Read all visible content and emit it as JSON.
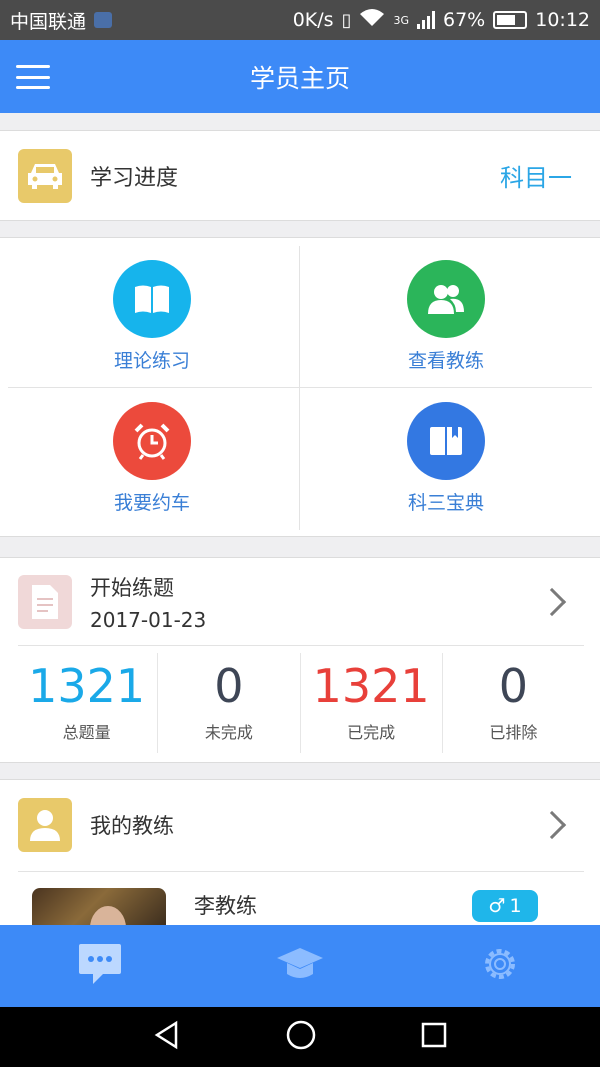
{
  "status_bar": {
    "carrier": "中国联通",
    "speed": "0K/s",
    "network": "3G",
    "battery": "67%",
    "time": "10:12"
  },
  "app_bar": {
    "title": "学员主页",
    "menu_icon": "hamburger-menu-icon"
  },
  "progress": {
    "icon": "car-icon",
    "icon_color": "#e8c96a",
    "label": "学习进度",
    "subject": "科目一"
  },
  "features": [
    {
      "label": "理论练习",
      "icon": "book-icon",
      "color": "#16b4ec"
    },
    {
      "label": "查看教练",
      "icon": "people-icon",
      "color": "#2bb55a"
    },
    {
      "label": "我要约车",
      "icon": "alarm-clock-icon",
      "color": "#ec4a3c"
    },
    {
      "label": "科三宝典",
      "icon": "bookmark-book-icon",
      "color": "#3378e2"
    }
  ],
  "practice": {
    "icon": "document-icon",
    "icon_color": "#f0d8d8",
    "title": "开始练题",
    "date": "2017-01-23",
    "stats": [
      {
        "value": "1321",
        "label": "总题量",
        "color": "#1aa9e8"
      },
      {
        "value": "0",
        "label": "未完成",
        "color": "#3e4656"
      },
      {
        "value": "1321",
        "label": "已完成",
        "color": "#e8403a"
      },
      {
        "value": "0",
        "label": "已排除",
        "color": "#3e4656"
      }
    ]
  },
  "coach": {
    "icon": "person-icon",
    "icon_color": "#e8c96a",
    "title": "我的教练",
    "name": "李教练",
    "gender_badge": "1",
    "gender_icon": "male-icon"
  },
  "tab_bar": [
    {
      "name": "message-icon"
    },
    {
      "name": "graduation-cap-icon"
    },
    {
      "name": "gear-icon"
    }
  ],
  "nav_bar": [
    "back-triangle-icon",
    "home-circle-icon",
    "recents-square-icon"
  ]
}
